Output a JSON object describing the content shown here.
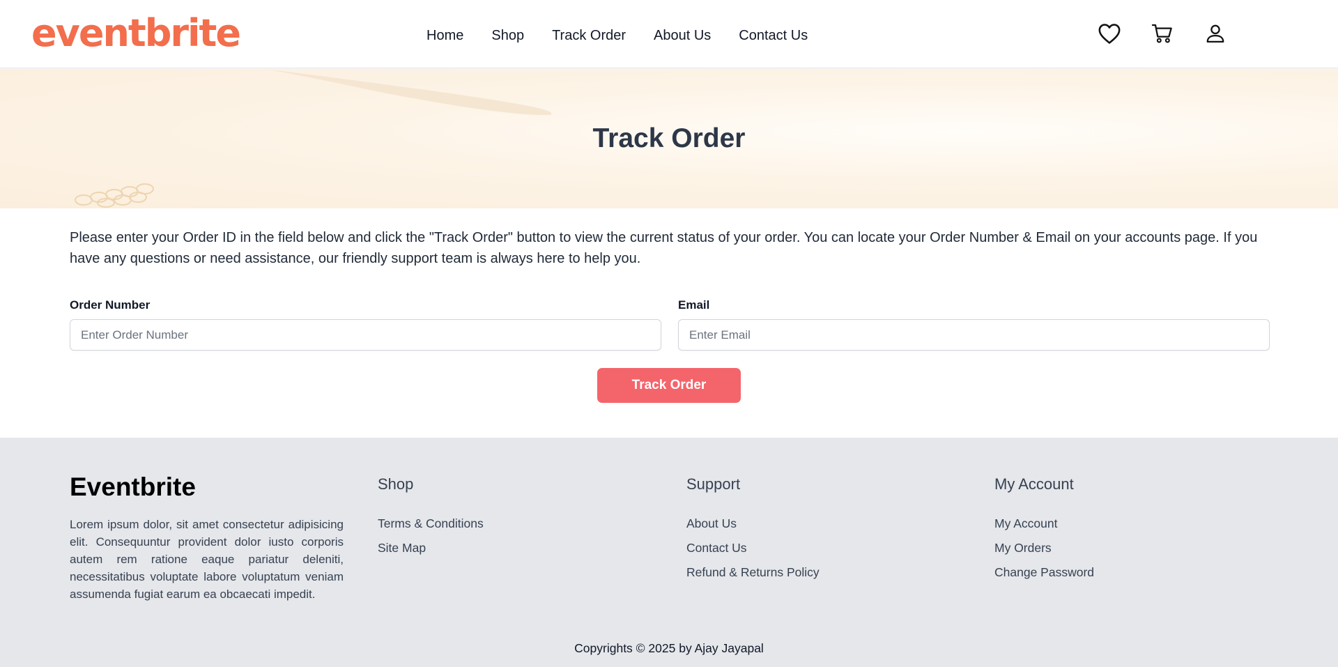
{
  "header": {
    "logo": "eventbrite",
    "nav": [
      "Home",
      "Shop",
      "Track Order",
      "About Us",
      "Contact Us"
    ],
    "icons": [
      "heart-icon",
      "cart-icon",
      "user-icon"
    ]
  },
  "hero": {
    "title": "Track Order"
  },
  "main": {
    "intro": "Please enter your Order ID in the field below and click the \"Track Order\" button to view the current status of your order. You can locate your Order Number & Email on your accounts page. If you have any questions or need assistance, our friendly support team is always here to help you.",
    "order_number_label": "Order Number",
    "order_number_placeholder": "Enter Order Number",
    "email_label": "Email",
    "email_placeholder": "Enter Email",
    "button_label": "Track Order"
  },
  "footer": {
    "brand": "Eventbrite",
    "description": "Lorem ipsum dolor, sit amet consectetur adipisicing elit. Consequuntur provident dolor iusto corporis autem rem ratione eaque pariatur deleniti, necessitatibus voluptate labore voluptatum veniam assumenda fugiat earum ea obcaecati impedit.",
    "shop": {
      "title": "Shop",
      "links": [
        "Terms & Conditions",
        "Site Map"
      ]
    },
    "support": {
      "title": "Support",
      "links": [
        "About Us",
        "Contact Us",
        "Refund & Returns Policy"
      ]
    },
    "account": {
      "title": "My Account",
      "links": [
        "My Account",
        "My Orders",
        "Change Password"
      ]
    },
    "copyright": "Copyrights © 2025 by Ajay Jayapal"
  },
  "colors": {
    "brand_orange": "#f26e4c",
    "button_red": "#f4646b",
    "footer_bg": "#e5e7eb",
    "hero_bg": "#fbeedd"
  }
}
